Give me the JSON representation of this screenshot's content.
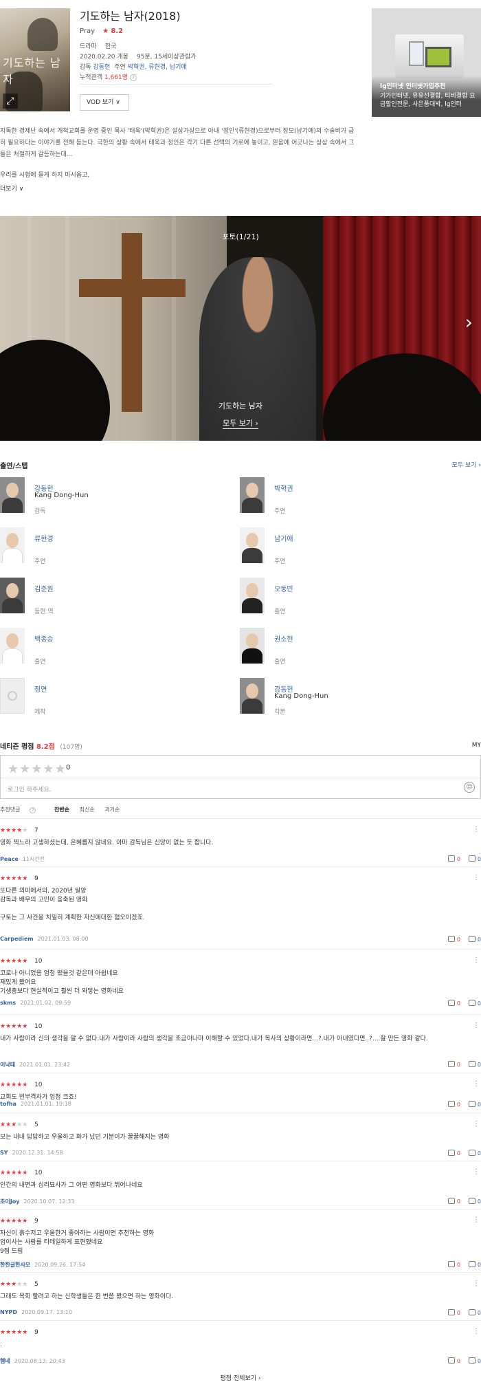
{
  "movie": {
    "title": "기도하는 남자(2018)",
    "eng_title": "Pray",
    "star": "★",
    "score": "8.2",
    "genre": "드라마",
    "country": "한국",
    "release": "2020.02.20 개봉",
    "runtime_rating": "95분, 15세이상관람가",
    "director_label": "감독",
    "director": "강동헌",
    "cast_label": "주연",
    "cast": "박혁권, 류현경, 남기애",
    "audience_label": "누적관객",
    "audience": "1,661명",
    "vod_button": "VOD 보기 ∨",
    "poster_title": "기도하는 남자"
  },
  "ad": {
    "title": "lg인터넷 인터넷가입추천",
    "body": "기가인터넷, 유유선결합, 티비결합 요금할인전문, 사은품대박, lg인터"
  },
  "synopsis": "지독한 경제난 속에서 개척교회를 운영 중인 목사 '태욱'(박혁권)은 설상가상으로 아내 '정인'(류현경)으로부터 장모(남기애)의 수술비가 급히 필요하다는 이야기를 전해 듣는다. 극한의 상황 속에서 태욱과 정인은 각기 다른 선택의 기로에 놓이고, 믿음에 어긋나는 상상 속에서 그들은 처절하게 갈등하는데...",
  "quote": "우리를 시험에 들게 하지 마시옵고,",
  "more": "더보기 ∨",
  "photo": {
    "label": "포토(1/21)",
    "caption": "기도하는 남자",
    "view_all": "모두 보기 ›",
    "next": "›"
  },
  "cast_section": {
    "title": "출연/스탭",
    "more": "모두 보기 ›",
    "people": [
      {
        "name": "강동헌",
        "eng": "Kang Dong-Hun",
        "role": "감독"
      },
      {
        "name": "박혁권",
        "eng": "",
        "role": "주연"
      },
      {
        "name": "류현경",
        "eng": "",
        "role": "주연"
      },
      {
        "name": "남기애",
        "eng": "",
        "role": "주연"
      },
      {
        "name": "김준원",
        "eng": "",
        "role": "동현 역"
      },
      {
        "name": "오동민",
        "eng": "",
        "role": "출연"
      },
      {
        "name": "백종승",
        "eng": "",
        "role": "출연"
      },
      {
        "name": "권소현",
        "eng": "",
        "role": "출연"
      },
      {
        "name": "정연",
        "eng": "",
        "role": "제작"
      },
      {
        "name": "강동헌",
        "eng": "Kang Dong-Hun",
        "role": "각본"
      }
    ]
  },
  "ratings": {
    "title": "네티즌 평점",
    "score": "8.2점",
    "count": "(107명)",
    "my": "MY",
    "empty_stars": "★★★★★",
    "my_score": "0",
    "placeholder": "로그인 하주세요.",
    "smile": "☺",
    "sort_recommend": "추천댓글",
    "sort_q": "?",
    "sort_like": "찬반순",
    "sort_new": "최신순",
    "sort_past": "과거순",
    "reviews": [
      {
        "score": "7",
        "stars": 3.5,
        "text": "영화 찍느라 고생하셨는데, 은혜롭지 않네요. 아마 감독님은 신앙이 없는 듯 합니다.",
        "author": "Peace",
        "date": "11시간전",
        "up": "0",
        "down": "0"
      },
      {
        "score": "9",
        "stars": 4.5,
        "text": "또다른 의미에서의, 2020년 밀양\n감독과 배우의 고민이 응축된 영화\n\n구토는  그 사건을 치밀히 계획한  자신에대한 혐오이겠죠.",
        "author": "Carpediem",
        "date": "2021.01.03. 08:00",
        "up": "0",
        "down": "0"
      },
      {
        "score": "10",
        "stars": 5,
        "text": "코로나 아니었음 엄청  떴을것 같은데 아쉽네요\n재밌게 봤어요\n기생충보다 현실적이고  훨씬  더 와닿는 영화네요",
        "author": "skms",
        "date": "2021.01.02. 09:59",
        "up": "0",
        "down": "0"
      },
      {
        "score": "10",
        "stars": 5,
        "text": "내가 사람이라 신의 생각을 알 수 없다.내가 사람이라 사람의 생각을 조금이나마 이해할 수 있었다.내가 목사의 상황이라면...?.내가 아내였다면..?....잘 만든 영화 같다.",
        "author": "이낙태",
        "date": "2021.01.01. 23:42",
        "up": "0",
        "down": "0"
      },
      {
        "score": "10",
        "stars": 5,
        "text": "교회도 빈부격차가 엄청 크죠!",
        "author": "tofha",
        "date": "2021.01.01. 10:18",
        "up": "0",
        "down": "0"
      },
      {
        "score": "5",
        "stars": 2.5,
        "text": "보는 내내 답답하고 우울하고 화가 났던 기분이가 꿀꿀해지는 영화",
        "author": "SY",
        "date": "2020.12.31. 14:58",
        "up": "0",
        "down": "0"
      },
      {
        "score": "10",
        "stars": 5,
        "text": "인간의 내면과 심리묘사가 그 어떤 영화보다 뛰어나네요",
        "author": "조이Joy",
        "date": "2020.10.07. 12:33",
        "up": "0",
        "down": "0"
      },
      {
        "score": "9",
        "stars": 4.5,
        "text": "자신이 흙수저고 우울한거 좋아하는 사람이면 추천하는 영화\n엄이사는 사람를 티테일하게 표현했네요\n9점 드림",
        "author": "한한글한사모",
        "date": "2020.09.26. 17:54",
        "up": "0",
        "down": "0"
      },
      {
        "score": "5",
        "stars": 2.5,
        "text": "그래도 목회 할려고 하는 신학생들은 한 번쯤 봤으면 하는 영화이다.",
        "author": "NYPD",
        "date": "2020.09.17. 13:10",
        "up": "0",
        "down": "0"
      },
      {
        "score": "9",
        "stars": 4.5,
        "text": ".",
        "author": "햄네",
        "date": "2020.08.13. 20:43",
        "up": "0",
        "down": "0"
      }
    ],
    "all_reviews": "평점 전체보기 ›"
  }
}
